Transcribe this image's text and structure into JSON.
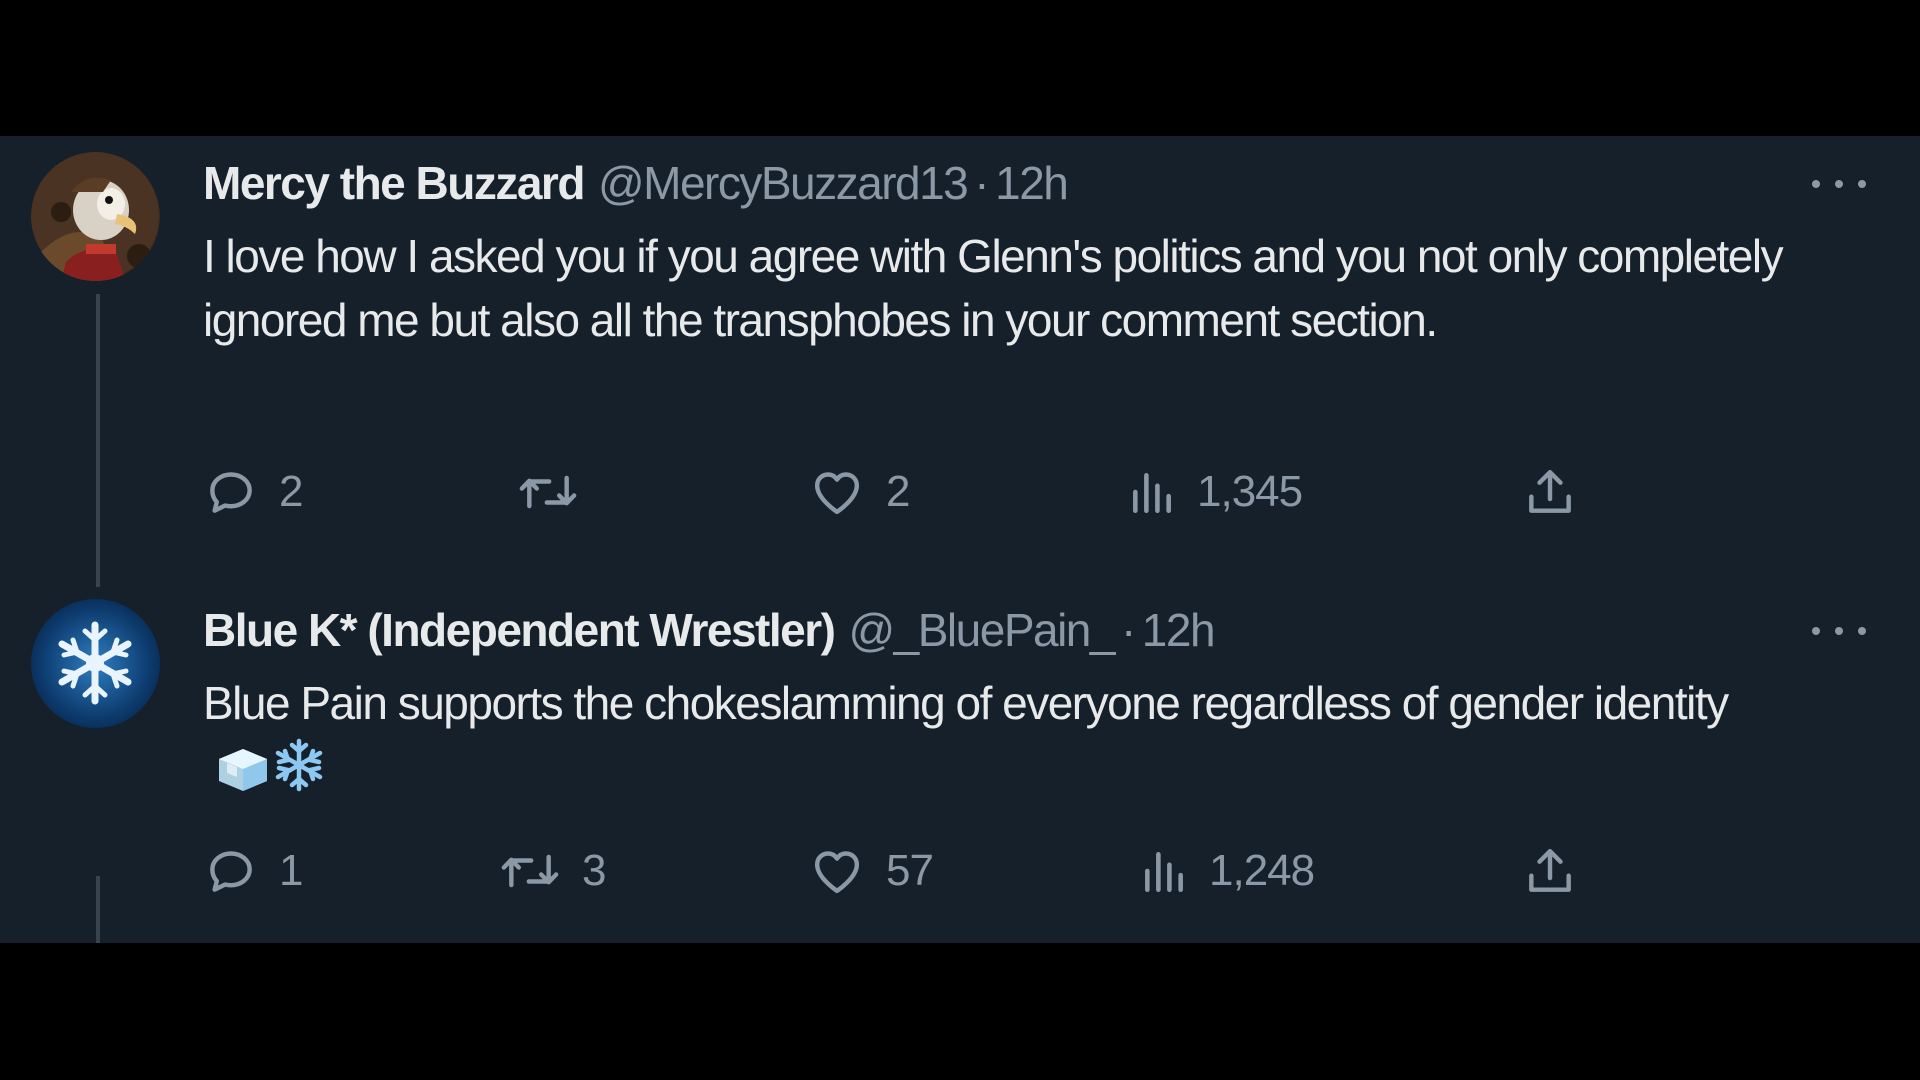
{
  "colors": {
    "page_background": "#000000",
    "panel_background": "#15202b",
    "primary_text": "#e7e9ea",
    "secondary_text": "#8b98a5",
    "thread_line": "#38444d"
  },
  "tweets": [
    {
      "display_name": "Mercy the Buzzard",
      "handle": "@MercyBuzzard13",
      "separator": "·",
      "time": "12h",
      "text": "I love how I asked you if you agree with Glenn's politics and you not only completely ignored me but also all the transphobes in your comment section.",
      "avatar_icon": "buzzard-avatar",
      "more_icon": "more-options-icon",
      "stats": {
        "replies": "2",
        "retweets": "",
        "likes": "2",
        "views": "1,345"
      }
    },
    {
      "display_name": "Blue K* (Independent Wrestler)",
      "handle": "@_BluePain_",
      "separator": "·",
      "time": "12h",
      "text": "Blue Pain supports the chokeslamming of everyone regardless of gender identity",
      "emojis": [
        "ice-cube-emoji",
        "snowflake-emoji"
      ],
      "avatar_icon": "snowflake-avatar",
      "more_icon": "more-options-icon",
      "stats": {
        "replies": "1",
        "retweets": "3",
        "likes": "57",
        "views": "1,248"
      }
    }
  ]
}
